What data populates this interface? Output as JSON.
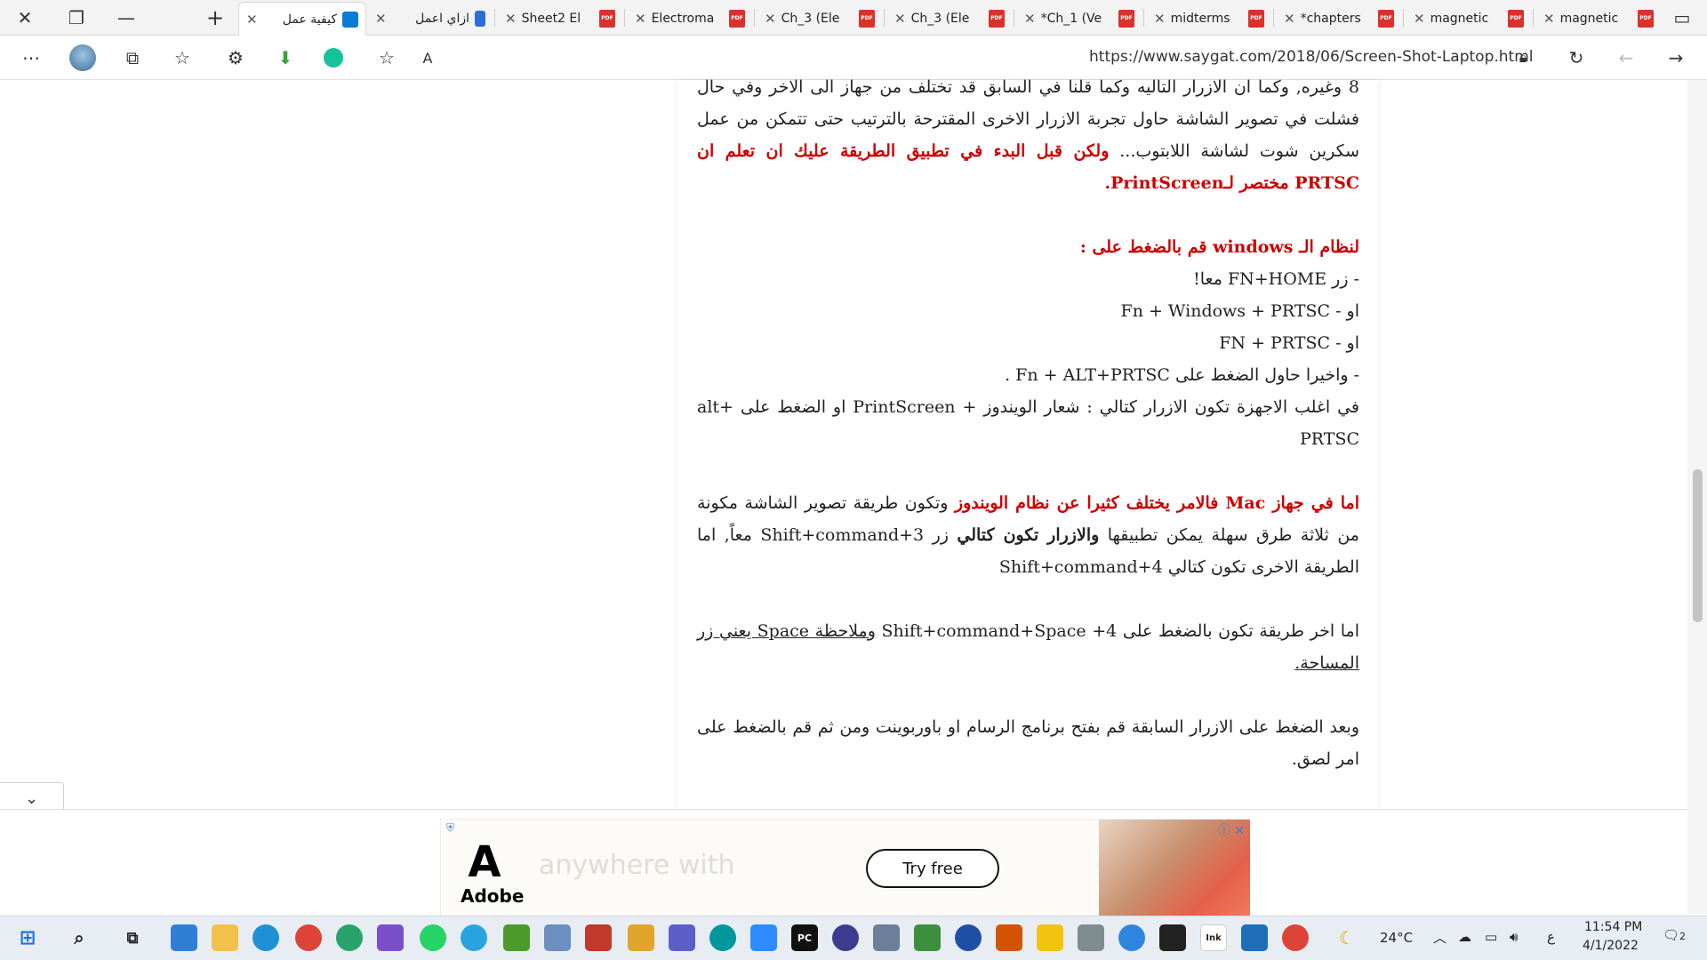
{
  "tabs": [
    {
      "label": "كيفية عمل",
      "active": true
    },
    {
      "label": "ازاي اعمل"
    },
    {
      "label": "Sheet2 El"
    },
    {
      "label": "Electroma"
    },
    {
      "label": "Ch_3 (Ele"
    },
    {
      "label": "Ch_3 (Ele"
    },
    {
      "label": "*Ch_1 (Ve"
    },
    {
      "label": "midterms"
    },
    {
      "label": "*chapters"
    },
    {
      "label": "magnetic"
    },
    {
      "label": "magnetic"
    }
  ],
  "address": {
    "url": "https://www.saygat.com/2018/06/Screen-Shot-Laptop.html"
  },
  "article": {
    "p1_a": "8 وغيره, وكما ان الازرار التاليه وكما قلنا في السابق قد تختلف من جهاز الى الاخر وفي حال فشلت في تصوير الشاشة حاول تجربة الازرار الاخرى المقترحة بالترتيب حتى تتمكن من عمل سكرين شوت لشاشة اللابتوب...",
    "p1_b": "ولكن قبل البدء في تطبيق الطريقة عليك ان تعلم ان PRTSC مختصر لـPrintScreen.",
    "win_heading": "لنظام الـ windows قم بالضغط على :",
    "win_l1": "- زر FN+HOME معا!",
    "win_l2": "او - Fn + Windows + PRTSC",
    "win_l3": "او -  FN + PRTSC",
    "win_l4": "- واخيرا حاول الضغط على Fn + ALT+PRTSC .",
    "win_l5": "في اغلب الاجهزة تكون الازرار كتالي : شعار الويندوز + PrintScreen او الضغط على  alt+ PRTSC",
    "mac_a": "اما في جهاز Mac فالامر يختلف كثيرا عن نظام الويندوز",
    "mac_b": " وتكون طريقة تصوير الشاشة مكونة من ثلاثة طرق سهلة يمكن تطبيقها ",
    "mac_c": "والازرار تكون كتالي",
    "mac_d": " زر Shift+command+3 معاً, اما الطريقة الاخرى تكون كتالي Shift+command+4",
    "last_a": "اما اخر طريقة تكون بالضغط على Shift+command+Space +4 ",
    "last_b": "وملاحظة Space يعني زر المساحة.",
    "after": "وبعد الضغط على الازرار السابقة قم بفتح برنامج الرسام او باوربوينت ومن ثم قم بالضغط على امر لصق."
  },
  "ad": {
    "brand": "Adobe",
    "tagline": "anywhere with",
    "cta": "Try free"
  },
  "taskbar": {
    "weather": "24°C",
    "lang": "ع",
    "time": "11:54 PM",
    "date": "4/1/2022",
    "notif": "2"
  }
}
